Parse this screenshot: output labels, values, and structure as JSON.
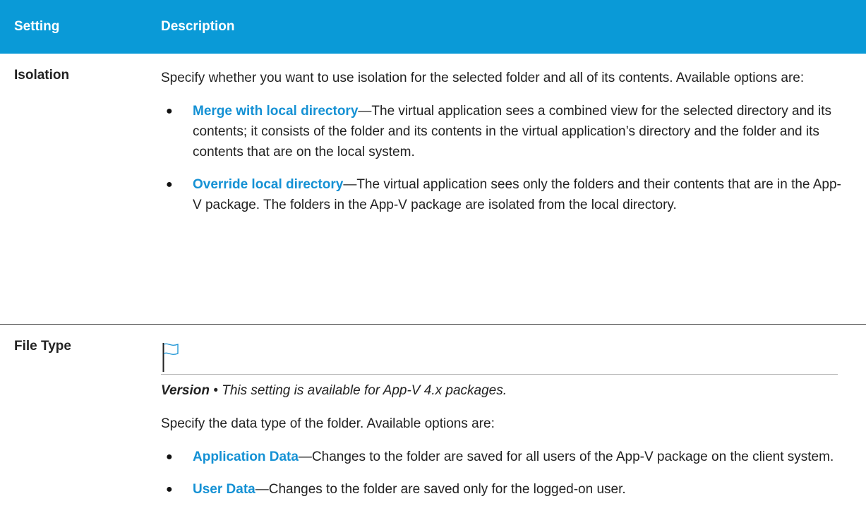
{
  "header": {
    "setting": "Setting",
    "description": "Description"
  },
  "rows": [
    {
      "setting": "Isolation",
      "intro": "Specify whether you want to use isolation for the selected folder and all of its contents. Available options are:",
      "options": [
        {
          "term": "Merge with local directory",
          "text": "—The virtual application sees a combined view for the selected directory and its contents; it consists of the folder and its contents in the virtual application’s directory and the folder and its contents that are on the local system."
        },
        {
          "term": "Override local directory",
          "text": "—The virtual application sees only the folders and their contents that are in the App-V package. The folders in the App-V package are isolated from the local directory."
        }
      ]
    },
    {
      "setting": "File Type",
      "version_label": "Version",
      "version_sep": " • ",
      "version_text": "This setting is available for App-V 4.x packages.",
      "intro": "Specify the data type of the folder. Available options are:",
      "options": [
        {
          "term": "Application Data",
          "text": "—Changes to the folder are saved for all users of the App-V package on the client system."
        },
        {
          "term": "User Data",
          "text": "—Changes to the folder are saved only for the logged-on user."
        }
      ]
    }
  ],
  "icons": {
    "bullet": "●",
    "version_flag": "flag-icon"
  },
  "colors": {
    "header_bg": "#0a9ad7",
    "term": "#1591d4"
  }
}
